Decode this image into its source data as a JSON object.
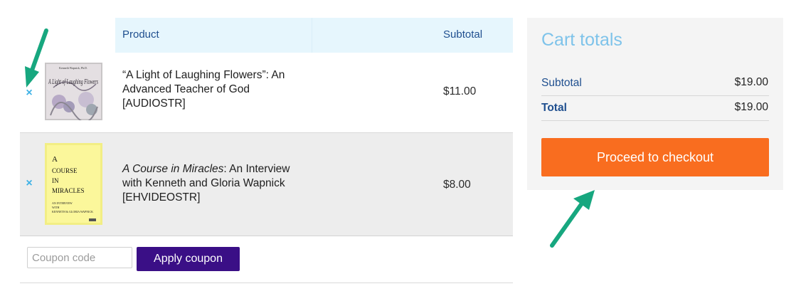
{
  "table": {
    "header_product": "Product",
    "header_subtotal": "Subtotal"
  },
  "items": [
    {
      "remove_icon": "×",
      "name": "“A Light of Laughing Flowers”: An Advanced Teacher of God [AUDIOSTR]",
      "price": "$11.00",
      "thumb": {
        "top_text": "Kenneth Wapnick, Ph.D.",
        "title": "A Light of Laughing Flowers"
      }
    },
    {
      "remove_icon": "×",
      "name_italic": "A Course in Miracles",
      "name_rest": ": An Interview with Kenneth and Gloria Wapnick [EHVIDEOSTR]",
      "price": "$8.00",
      "thumb": {
        "line1": "A",
        "line2": "COURSE",
        "line3": "IN",
        "line4": "MIRACLES",
        "sub1": "AN INTERVIEW",
        "sub2": "WITH",
        "sub3": "KENNETH & GLORIA WAPNICK"
      }
    }
  ],
  "coupon": {
    "placeholder": "Coupon code",
    "apply_label": "Apply coupon"
  },
  "totals": {
    "title": "Cart totals",
    "subtotal_label": "Subtotal",
    "subtotal_value": "$19.00",
    "total_label": "Total",
    "total_value": "$19.00",
    "checkout_label": "Proceed to checkout"
  },
  "colors": {
    "accent_blue": "#3fb2e6",
    "header_bg": "#e6f6fd",
    "coupon_button": "#3a0f86",
    "checkout_button": "#f96d1f",
    "annotation_arrow": "#17a77f"
  }
}
